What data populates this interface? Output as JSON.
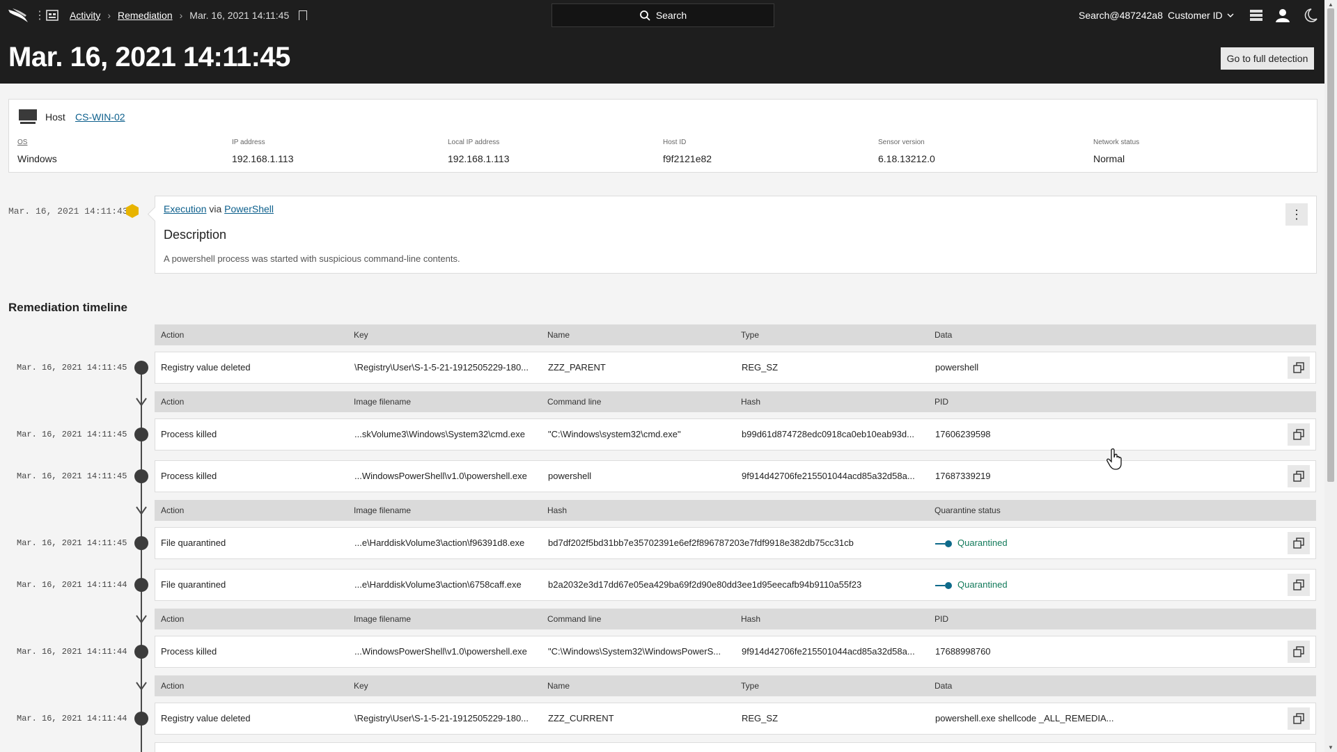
{
  "nav": {
    "breadcrumb": [
      "Activity",
      "Remediation"
    ],
    "current": "Mar. 16, 2021 14:11:45",
    "search_label": "Search",
    "account": "Search@487242a8",
    "customer_label": "Customer ID"
  },
  "page": {
    "title": "Mar. 16, 2021 14:11:45",
    "full_detection_label": "Go to full detection"
  },
  "host": {
    "label": "Host",
    "name": "CS-WIN-02",
    "fields": [
      {
        "label": "OS",
        "value": "Windows"
      },
      {
        "label": "IP address",
        "value": "192.168.1.113"
      },
      {
        "label": "Local IP address",
        "value": "192.168.1.113"
      },
      {
        "label": "Host ID",
        "value": "f9f2121e82"
      },
      {
        "label": "Sensor version",
        "value": "6.18.13212.0"
      },
      {
        "label": "Network status",
        "value": "Normal"
      }
    ]
  },
  "detection": {
    "time": "Mar. 16, 2021 14:11:43",
    "tactic": "Execution",
    "via": "via",
    "technique": "PowerShell",
    "desc_title": "Description",
    "description": "A powershell process was started with suspicious command-line contents."
  },
  "timeline": {
    "title": "Remediation timeline",
    "headers": {
      "registry": [
        "Action",
        "Key",
        "Name",
        "Type",
        "Data"
      ],
      "process": [
        "Action",
        "Image filename",
        "Command line",
        "Hash",
        "PID"
      ],
      "file": [
        "Action",
        "Image filename",
        "Hash",
        "Quarantine status"
      ]
    },
    "rows": [
      {
        "time": "Mar. 16, 2021 14:11:45",
        "cells": [
          "Registry value deleted",
          "\\Registry\\User\\S-1-5-21-1912505229-180...",
          "ZZZ_PARENT",
          "REG_SZ",
          "powershell"
        ]
      },
      {
        "time": "Mar. 16, 2021 14:11:45",
        "cells": [
          "Process killed",
          "...skVolume3\\Windows\\System32\\cmd.exe",
          "\"C:\\Windows\\system32\\cmd.exe\"",
          "b99d61d874728edc0918ca0eb10eab93d...",
          "17606239598"
        ]
      },
      {
        "time": "Mar. 16, 2021 14:11:45",
        "cells": [
          "Process killed",
          "...WindowsPowerShell\\v1.0\\powershell.exe",
          "powershell",
          "9f914d42706fe215501044acd85a32d58a...",
          "17687339219"
        ]
      },
      {
        "time": "Mar. 16, 2021 14:11:45",
        "cells": [
          "File quarantined",
          "...e\\HarddiskVolume3\\action\\f96391d8.exe",
          "bd7df202f5bd31bb7e35702391e6ef2f896787203e7fdf9918e382db75cc31cb",
          "Quarantined"
        ]
      },
      {
        "time": "Mar. 16, 2021 14:11:44",
        "cells": [
          "File quarantined",
          "...e\\HarddiskVolume3\\action\\6758caff.exe",
          "b2a2032e3d17dd67e05ea429ba69f2d90e80dd3ee1d95eecafb94b9110a55f23",
          "Quarantined"
        ]
      },
      {
        "time": "Mar. 16, 2021 14:11:44",
        "cells": [
          "Process killed",
          "...WindowsPowerShell\\v1.0\\powershell.exe",
          "\"C:\\Windows\\System32\\WindowsPowerS...",
          "9f914d42706fe215501044acd85a32d58a...",
          "17688998760"
        ]
      },
      {
        "time": "Mar. 16, 2021 14:11:44",
        "cells": [
          "Registry value deleted",
          "\\Registry\\User\\S-1-5-21-1912505229-180...",
          "ZZZ_CURRENT",
          "REG_SZ",
          "powershell.exe shellcode _ALL_REMEDIA..."
        ]
      }
    ]
  },
  "icons": [
    "falcon-logo-icon",
    "apps-icon",
    "bookmark-icon",
    "search-icon",
    "chevron-down-icon",
    "layers-icon",
    "user-icon",
    "moon-icon",
    "monitor-icon",
    "more-vertical-icon",
    "copy-icon",
    "hand-cursor-icon"
  ],
  "colors": {
    "topbar": "#1e1e1e",
    "link": "#0c5f8c",
    "severity": "#e8b400",
    "quarantined": "#127a5a"
  }
}
